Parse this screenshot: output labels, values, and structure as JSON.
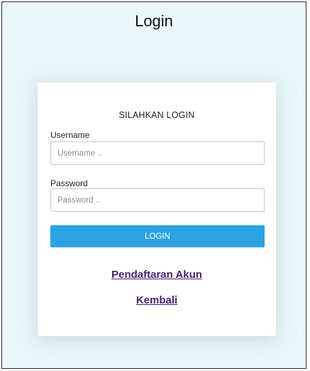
{
  "page": {
    "title": "Login"
  },
  "form": {
    "heading": "SILAHKAN LOGIN",
    "username": {
      "label": "Username",
      "placeholder": "Username ..",
      "value": ""
    },
    "password": {
      "label": "Password",
      "placeholder": "Password ..",
      "value": ""
    },
    "login_button_label": "LOGIN"
  },
  "links": {
    "register_label": "Pendaftaran Akun",
    "back_label": "Kembali"
  },
  "colors": {
    "background": "#eaf8fa",
    "button": "#2ba3e3",
    "link": "#4a1f70"
  }
}
